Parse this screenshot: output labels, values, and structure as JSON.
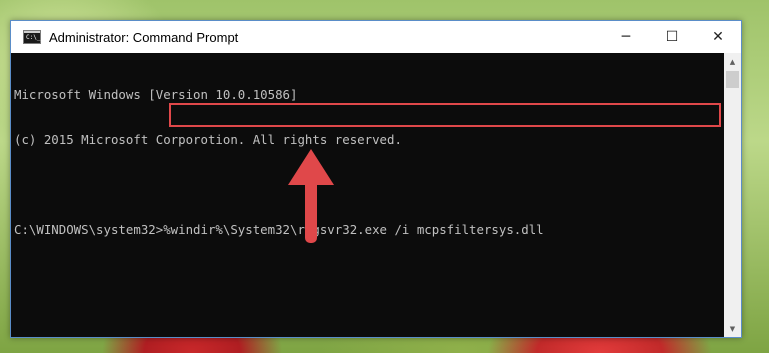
{
  "window": {
    "title": "Administrator: Command Prompt",
    "icon": "cmd-icon",
    "icon_glyph": "C:\\_",
    "controls": {
      "minimize_glyph": "─",
      "maximize_glyph": "☐",
      "close_glyph": "✕"
    }
  },
  "console": {
    "lines": [
      "Microsoft Windows [Version 10.0.10586]",
      "(c) 2015 Microsoft Corporotion. All rights reserved.",
      "",
      "C:\\WINDOWS\\system32>%windir%\\System32\\regsvr32.exe /i mcpsfiltersys.dll"
    ]
  },
  "scrollbar": {
    "up_glyph": "▲",
    "down_glyph": "▼"
  },
  "annotation": {
    "highlight_color": "#e0484a",
    "arrow_color": "#e0484a",
    "arrow_direction": "up"
  }
}
